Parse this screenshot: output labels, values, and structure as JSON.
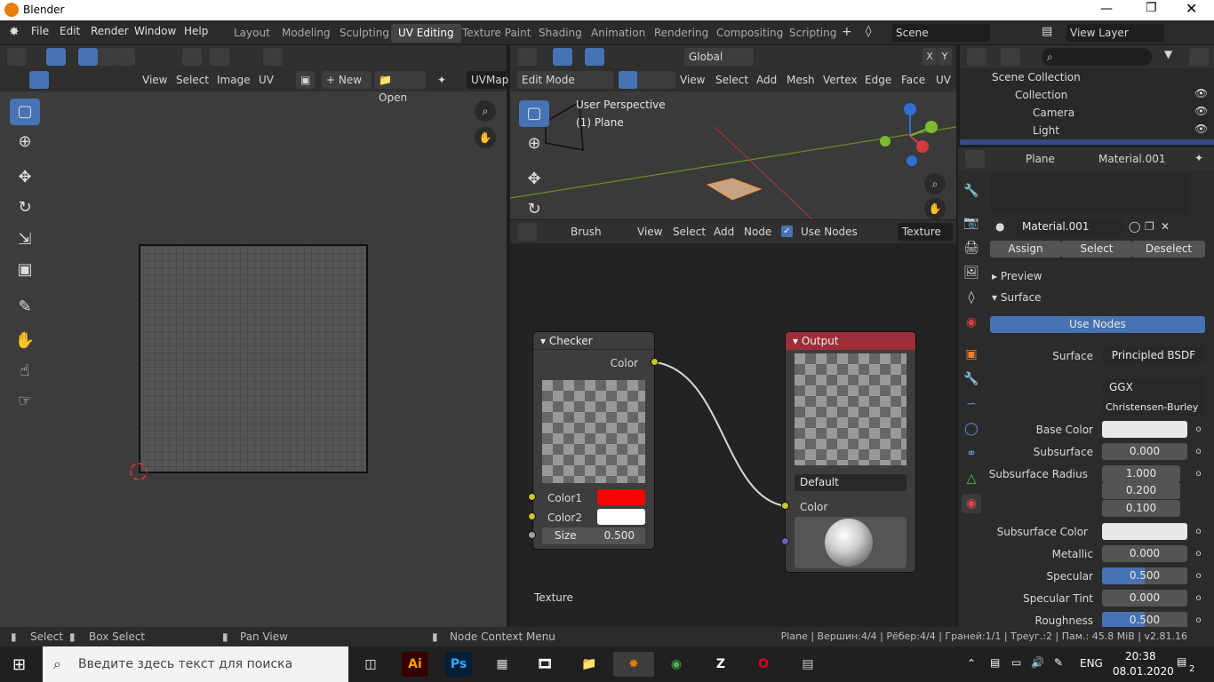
{
  "title": "Blender",
  "menus": [
    "File",
    "Edit",
    "Render",
    "Window",
    "Help"
  ],
  "workspaces": [
    "Layout",
    "Modeling",
    "Sculpting",
    "UV Editing",
    "Texture Paint",
    "Shading",
    "Animation",
    "Rendering",
    "Compositing",
    "Scripting"
  ],
  "scene": "Scene",
  "view_layer": "View Layer",
  "uv_editor": {
    "menus": [
      "View",
      "Select",
      "Image",
      "UV"
    ],
    "new_label": "New",
    "open_label": "Open",
    "uvmap": "UVMap"
  },
  "viewport": {
    "mode": "Edit Mode",
    "transform": "Global",
    "menus": [
      "View",
      "Select",
      "Add",
      "Mesh",
      "Vertex",
      "Edge",
      "Face",
      "UV"
    ],
    "perspective": "User Perspective",
    "object": "(1) Plane"
  },
  "node_editor": {
    "brush": "Brush",
    "menus": [
      "View",
      "Select",
      "Add",
      "Node"
    ],
    "use_nodes": "Use Nodes",
    "texture": "Texture",
    "footer_label": "Texture",
    "checker": {
      "title": "Checker",
      "out": "Color",
      "color1": "Color1",
      "color2": "Color2",
      "size_label": "Size",
      "size_value": "0.500",
      "color1_hex": "#ff0000",
      "color2_hex": "#ffffff"
    },
    "output": {
      "title": "Output",
      "default": "Default",
      "color": "Color"
    }
  },
  "outliner": {
    "search_placeholder": "",
    "items": [
      {
        "label": "Scene Collection"
      },
      {
        "label": "Collection"
      },
      {
        "label": "Camera"
      },
      {
        "label": "Light"
      }
    ]
  },
  "properties": {
    "object": "Plane",
    "material": "Material.001",
    "slot_material": "Material.001",
    "assign": "Assign",
    "select": "Select",
    "deselect": "Deselect",
    "preview": "Preview",
    "surface_panel": "Surface",
    "use_nodes": "Use Nodes",
    "rows": [
      {
        "label": "Surface",
        "value": "Principled BSDF"
      },
      {
        "label": "",
        "value": "GGX"
      },
      {
        "label": "",
        "value": "Christensen-Burley"
      },
      {
        "label": "Base Color",
        "value": ""
      },
      {
        "label": "Subsurface",
        "value": "0.000"
      },
      {
        "label": "Subsurface Radius",
        "value": "1.000"
      },
      {
        "label": "",
        "value": "0.200"
      },
      {
        "label": "",
        "value": "0.100"
      },
      {
        "label": "Subsurface Color",
        "value": ""
      },
      {
        "label": "Metallic",
        "value": "0.000"
      },
      {
        "label": "Specular",
        "value": "0.500"
      },
      {
        "label": "Specular Tint",
        "value": "0.000"
      },
      {
        "label": "Roughness",
        "value": "0.500"
      }
    ]
  },
  "status": {
    "select": "Select",
    "box_select": "Box Select",
    "pan_view": "Pan View",
    "node_ctx": "Node Context Menu",
    "info": "Plane | Вершин:4/4 | Рёбер:4/4 | Граней:1/1 | Треуг.:2 | Пам.: 45.8 MiB | v2.81.16"
  },
  "taskbar": {
    "search_placeholder": "Введите здесь текст для поиска",
    "lang": "ENG",
    "time": "20:38",
    "date": "08.01.2020",
    "notif": "2"
  }
}
